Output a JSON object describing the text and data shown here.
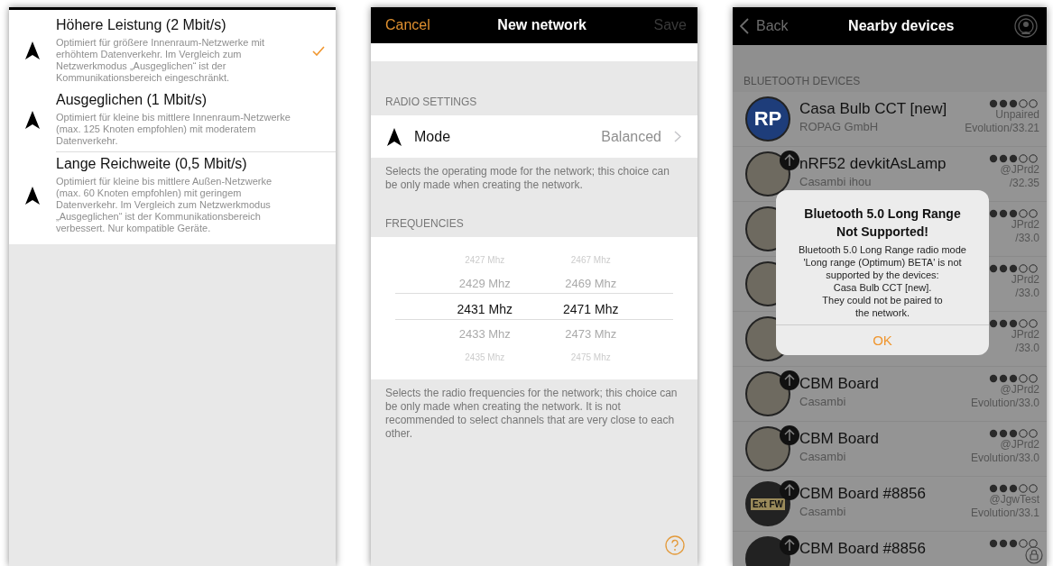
{
  "mode_screen": {
    "options": [
      {
        "title": "Höhere Leistung (2 Mbit/s)",
        "description": "Optimiert für größere Innenraum-Netzwerke mit erhöhtem Datenverkehr. Im Vergleich zum Netzwerkmodus „Ausgeglichen“ ist der Kommunikationsbereich eingeschränkt.",
        "selected": true
      },
      {
        "title": "Ausgeglichen (1 Mbit/s)",
        "description": "Optimiert für kleine bis mittlere Innenraum-Netzwerke (max. 125 Knoten empfohlen) mit moderatem Datenverkehr.",
        "selected": false
      },
      {
        "title": "Lange Reichweite (0,5 Mbit/s)",
        "description": "Optimiert für kleine bis mittlere Außen-Netzwerke (max. 60 Knoten empfohlen) mit geringem Datenverkehr. Im Vergleich zum Netzwerkmodus „Ausgeglichen“ ist der Kommunikationsbereich verbessert. Nur kompatible Geräte.",
        "selected": false
      }
    ]
  },
  "new_network_screen": {
    "nav": {
      "cancel": "Cancel",
      "title": "New network",
      "save": "Save",
      "save_disabled": true
    },
    "radio_settings": {
      "header": "RADIO SETTINGS",
      "row": {
        "label": "Mode",
        "value": "Balanced"
      },
      "footer": "Selects the operating mode for the network; this choice can be only made when creating the network."
    },
    "frequencies": {
      "header": "FREQUENCIES",
      "columns": [
        {
          "items": [
            {
              "label": "2427 Mhz",
              "selected": false
            },
            {
              "label": "2429 Mhz",
              "selected": false
            },
            {
              "label": "2431 Mhz",
              "selected": true
            },
            {
              "label": "2433 Mhz",
              "selected": false
            },
            {
              "label": "2435 Mhz",
              "selected": false
            }
          ]
        },
        {
          "items": [
            {
              "label": "2467 Mhz",
              "selected": false
            },
            {
              "label": "2469 Mhz",
              "selected": false
            },
            {
              "label": "2471 Mhz",
              "selected": true
            },
            {
              "label": "2473 Mhz",
              "selected": false
            },
            {
              "label": "2475 Mhz",
              "selected": false
            }
          ]
        }
      ],
      "footer": "Selects the radio frequencies for the network; this choice can be only made when creating the network. It is not recommended to select channels that are very close to each other."
    }
  },
  "nearby_devices_screen": {
    "nav": {
      "back": "Back",
      "title": "Nearby devices"
    },
    "section_header": "BLUETOOTH DEVICES",
    "devices": [
      {
        "kind": "logo",
        "avatar_label": "RP",
        "update_badge": false,
        "name": "Casa Bulb CCT [new]",
        "vendor": "ROPAG GmbH",
        "status": "Unpaired",
        "version": "Evolution/33.21"
      },
      {
        "kind": "photo",
        "update_badge": true,
        "name": "nRF52 devkitAsLamp",
        "vendor": "Casambi ihou",
        "status": "@JPrd2",
        "version": "/32.35"
      },
      {
        "kind": "photo",
        "update_badge": false,
        "status": "JPrd2",
        "version": "/33.0"
      },
      {
        "kind": "photo",
        "update_badge": false,
        "status": "JPrd2",
        "version": "/33.0"
      },
      {
        "kind": "photo",
        "update_badge": false,
        "status": "JPrd2",
        "version": "/33.0"
      },
      {
        "kind": "photo",
        "update_badge": true,
        "name": "CBM Board",
        "vendor": "Casambi",
        "status": "@JPrd2",
        "version": "Evolution/33.0"
      },
      {
        "kind": "photo",
        "update_badge": true,
        "name": "CBM Board",
        "vendor": "Casambi",
        "status": "@JPrd2",
        "version": "Evolution/33.0"
      },
      {
        "kind": "firmware",
        "avatar_label": "Ext FW",
        "update_badge": true,
        "name": "CBM Board #8856",
        "vendor": "Casambi",
        "status": "@JgwTest",
        "version": "Evolution/33.1"
      },
      {
        "kind": "firmware",
        "update_badge": true,
        "name": "CBM Board #8856"
      }
    ],
    "alert": {
      "title": "Bluetooth 5.0 Long Range Not Supported!",
      "message": "Bluetooth 5.0 Long Range radio mode 'Long range (Optimum) BETA' is not supported by the devices:\nCasa Bulb CCT [new].\nThey could not be paired to\nthe network.",
      "button": "OK"
    }
  }
}
